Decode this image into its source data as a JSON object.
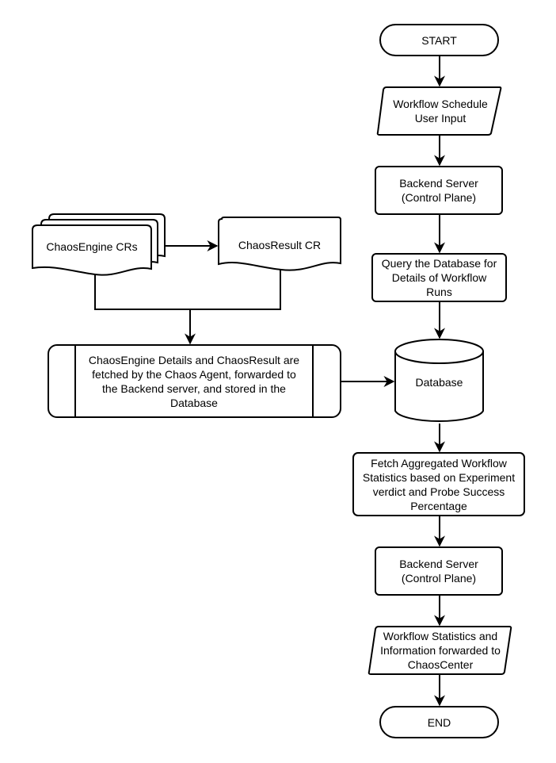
{
  "diagram": {
    "type": "flowchart",
    "nodes": {
      "start": {
        "label": "START",
        "shape": "terminator"
      },
      "schedule_input": {
        "label": "Workflow Schedule\nUser Input",
        "shape": "data"
      },
      "backend_1": {
        "label": "Backend Server\n(Control Plane)",
        "shape": "process"
      },
      "query_db": {
        "label": "Query the Database for\nDetails of Workflow\nRuns",
        "shape": "process"
      },
      "database": {
        "label": "Database",
        "shape": "cylinder"
      },
      "fetch_stats": {
        "label": "Fetch Aggregated Workflow\nStatistics based on Experiment\nverdict and Probe Success\nPercentage",
        "shape": "process"
      },
      "backend_2": {
        "label": "Backend Server\n(Control Plane)",
        "shape": "process"
      },
      "forward_stats": {
        "label": "Workflow Statistics and\nInformation forwarded to\nChaosCenter",
        "shape": "data"
      },
      "end": {
        "label": "END",
        "shape": "terminator"
      },
      "chaosengine_crs": {
        "label": "ChaosEngine CRs",
        "shape": "multi-document"
      },
      "chaosresult_cr": {
        "label": "ChaosResult CR",
        "shape": "document"
      },
      "agent_process": {
        "label": "ChaosEngine Details and ChaosResult are\nfetched by the Chaos Agent, forwarded to\nthe Backend server, and stored in the\nDatabase",
        "shape": "predefined-process"
      }
    },
    "edges": [
      {
        "from": "start",
        "to": "schedule_input"
      },
      {
        "from": "schedule_input",
        "to": "backend_1"
      },
      {
        "from": "backend_1",
        "to": "query_db"
      },
      {
        "from": "query_db",
        "to": "database"
      },
      {
        "from": "database",
        "to": "fetch_stats"
      },
      {
        "from": "fetch_stats",
        "to": "backend_2"
      },
      {
        "from": "backend_2",
        "to": "forward_stats"
      },
      {
        "from": "forward_stats",
        "to": "end"
      },
      {
        "from": "chaosengine_crs",
        "to": "chaosresult_cr"
      },
      {
        "from": "chaosengine_crs",
        "to": "agent_process"
      },
      {
        "from": "chaosresult_cr",
        "to": "agent_process"
      },
      {
        "from": "agent_process",
        "to": "database"
      }
    ]
  }
}
